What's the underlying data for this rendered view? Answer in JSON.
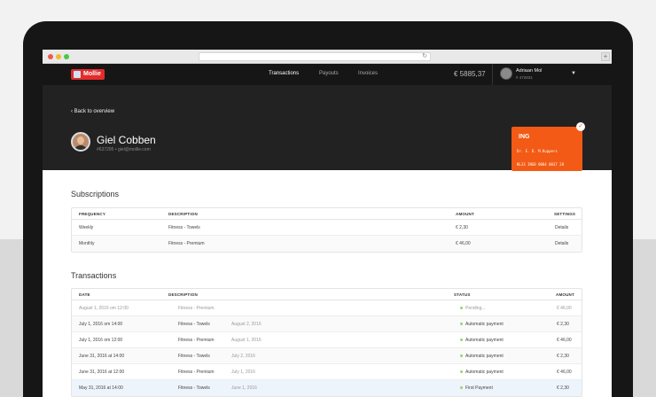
{
  "browser": {
    "reload_icon": "reload-icon",
    "add_tab": "+"
  },
  "brand": {
    "name": "Mollie",
    "accent": "#e22c2c"
  },
  "nav": {
    "items": [
      {
        "label": "Transactions",
        "active": true
      },
      {
        "label": "Payouts",
        "active": false
      },
      {
        "label": "Invoices",
        "active": false
      }
    ],
    "balance": "€ 5885,37"
  },
  "account": {
    "name": "Adriaan Mol",
    "sub": "# 472831"
  },
  "profile": {
    "back_label": "Back to overview",
    "name": "Giel Cobben",
    "meta": "#637295  •  giel@mollie.com"
  },
  "bank_card": {
    "bank": "ING",
    "holder": "Dr. E. D. M.Kuppers",
    "iban": "NL33 INGB 0004 0037 28",
    "color": "#f25a15"
  },
  "subscriptions": {
    "title": "Subscriptions",
    "columns": [
      "FREQUENCY",
      "DESCRIPTION",
      "AMOUNT",
      "SETTINGS"
    ],
    "rows": [
      {
        "frequency": "Weekly",
        "description": "Fitness - Towels",
        "amount": "€   2,30",
        "settings": "Details"
      },
      {
        "frequency": "Monthly",
        "description": "Fitness - Premium",
        "amount": "€  46,00",
        "settings": "Details"
      }
    ]
  },
  "transactions": {
    "title": "Transactions",
    "columns": [
      "DATE",
      "DESCRIPTION",
      "STATUS",
      "AMOUNT"
    ],
    "rows": [
      {
        "date": "August 1, 2016 om 12:00",
        "description": "Fitness - Premium",
        "sub": "",
        "status": "Pending...",
        "status_color": "#9bd06e",
        "amount": "€  46,00",
        "muted": true
      },
      {
        "date": "July 1, 2016 om 14:00",
        "description": "Fitness - Towels",
        "sub": "August 2, 2016",
        "status": "Automatic payment",
        "status_color": "#9bd06e",
        "amount": "€   2,30",
        "muted": false
      },
      {
        "date": "July 1, 2016 om 12:00",
        "description": "Fitness - Premium",
        "sub": "August 1, 2016",
        "status": "Automatic payment",
        "status_color": "#9bd06e",
        "amount": "€  46,00",
        "muted": false
      },
      {
        "date": "June 31, 2016 at 14:00",
        "description": "Fitness - Towels",
        "sub": "July 2, 2016",
        "status": "Automatic payment",
        "status_color": "#9bd06e",
        "amount": "€   2,30",
        "muted": false
      },
      {
        "date": "June 31, 2016 at 12:00",
        "description": "Fitness - Premium",
        "sub": "July 1, 2016",
        "status": "Automatic payment",
        "status_color": "#9bd06e",
        "amount": "€  46,00",
        "muted": false
      },
      {
        "date": "May 31, 2016 at 14:00",
        "description": "Fitness - Towels",
        "sub": "June 1, 2016",
        "status": "First Payment",
        "status_color": "#9bd06e",
        "amount": "€   2,30",
        "muted": false
      }
    ]
  }
}
